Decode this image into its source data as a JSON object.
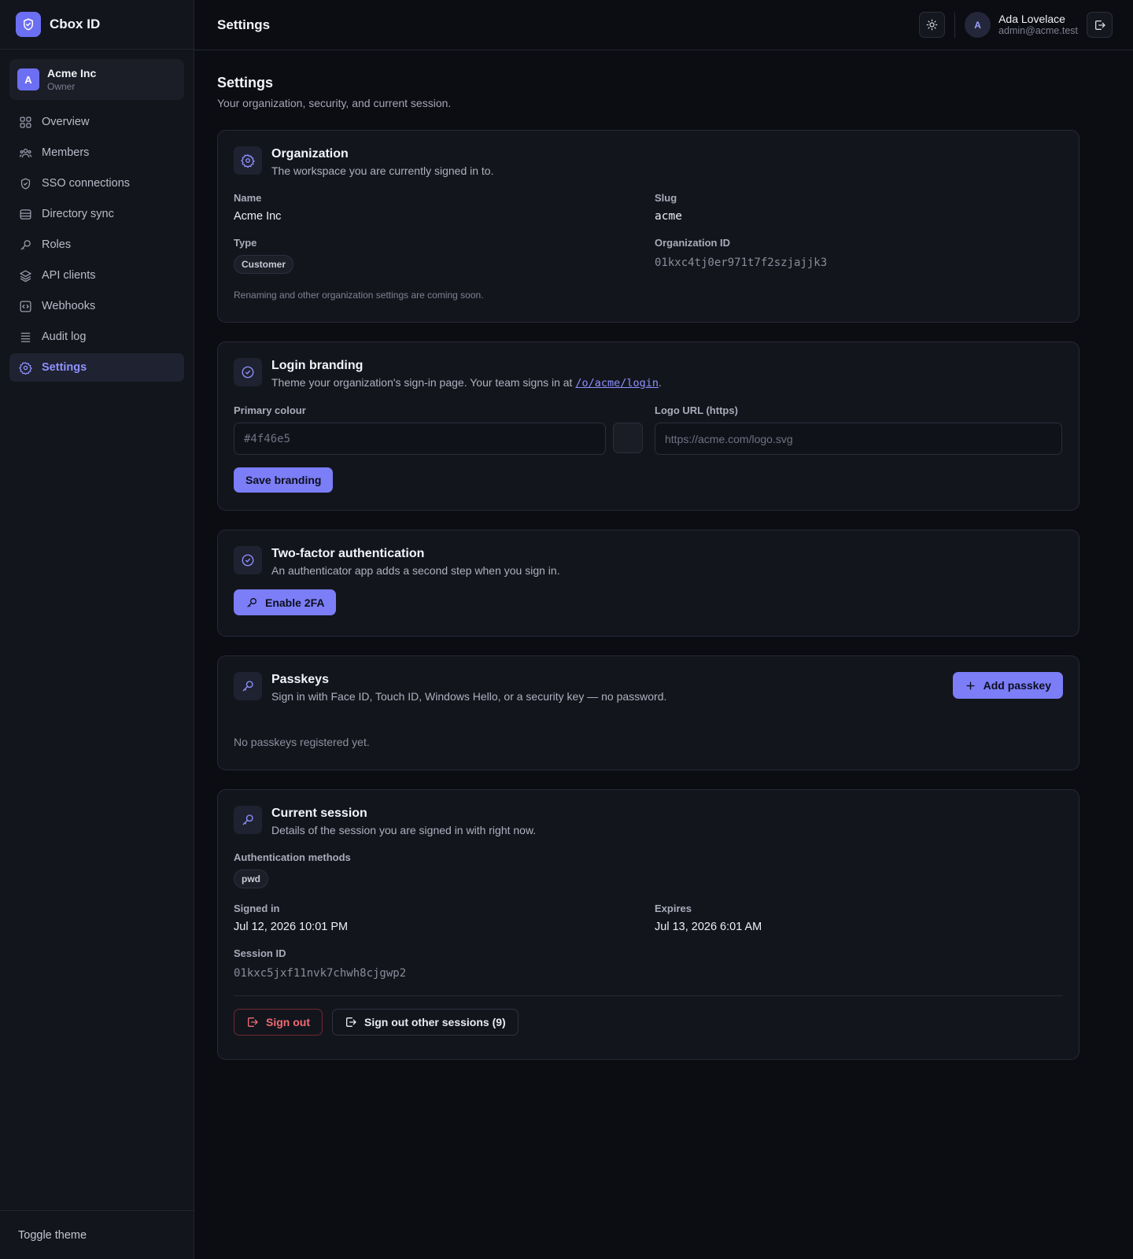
{
  "app": {
    "name": "Cbox ID",
    "brand_color": "#6c6ff2"
  },
  "org": {
    "avatar": "A",
    "name": "Acme Inc",
    "role": "Owner"
  },
  "nav": {
    "items": [
      {
        "label": "Overview",
        "icon": "grid-icon"
      },
      {
        "label": "Members",
        "icon": "users-icon"
      },
      {
        "label": "SSO connections",
        "icon": "shield-icon"
      },
      {
        "label": "Directory sync",
        "icon": "database-icon"
      },
      {
        "label": "Roles",
        "icon": "key-icon"
      },
      {
        "label": "API clients",
        "icon": "layers-icon"
      },
      {
        "label": "Webhooks",
        "icon": "code-icon"
      },
      {
        "label": "Audit log",
        "icon": "list-icon"
      },
      {
        "label": "Settings",
        "icon": "gear-icon",
        "active": true
      }
    ],
    "footer": "Toggle theme"
  },
  "header": {
    "title": "Settings",
    "user": {
      "avatar": "A",
      "name": "Ada Lovelace",
      "email": "admin@acme.test"
    }
  },
  "page": {
    "title": "Settings",
    "subtitle": "Your organization, security, and current session."
  },
  "organization": {
    "title": "Organization",
    "desc": "The workspace you are currently signed in to.",
    "name_label": "Name",
    "name": "Acme Inc",
    "slug_label": "Slug",
    "slug": "acme",
    "type_label": "Type",
    "type": "Customer",
    "id_label": "Organization ID",
    "id": "01kxc4tj0er971t7f2szjajjk3",
    "note": "Renaming and other organization settings are coming soon."
  },
  "branding": {
    "title": "Login branding",
    "desc_prefix": "Theme your organization's sign-in page. Your team signs in at ",
    "login_path": "/o/acme/login",
    "desc_suffix": ".",
    "color_label": "Primary colour",
    "color_placeholder": "#4f46e5",
    "logo_label": "Logo URL (https)",
    "logo_placeholder": "https://acme.com/logo.svg",
    "save_label": "Save branding"
  },
  "twofa": {
    "title": "Two-factor authentication",
    "desc": "An authenticator app adds a second step when you sign in.",
    "button": "Enable 2FA"
  },
  "passkeys": {
    "title": "Passkeys",
    "desc": "Sign in with Face ID, Touch ID, Windows Hello, or a security key — no password.",
    "add_label": "Add passkey",
    "empty": "No passkeys registered yet."
  },
  "session": {
    "title": "Current session",
    "desc": "Details of the session you are signed in with right now.",
    "methods_label": "Authentication methods",
    "methods": [
      "pwd"
    ],
    "signed_in_label": "Signed in",
    "signed_in": "Jul 12, 2026 10:01 PM",
    "expires_label": "Expires",
    "expires": "Jul 13, 2026 6:01 AM",
    "id_label": "Session ID",
    "id": "01kxc5jxf11nvk7chwh8cjgwp2",
    "sign_out": "Sign out",
    "sign_out_others": "Sign out other sessions (9)"
  },
  "colors": {
    "accent": "#7b7ef7",
    "danger": "#f06b72",
    "background": "#0c0d13",
    "card": "#13151d"
  }
}
